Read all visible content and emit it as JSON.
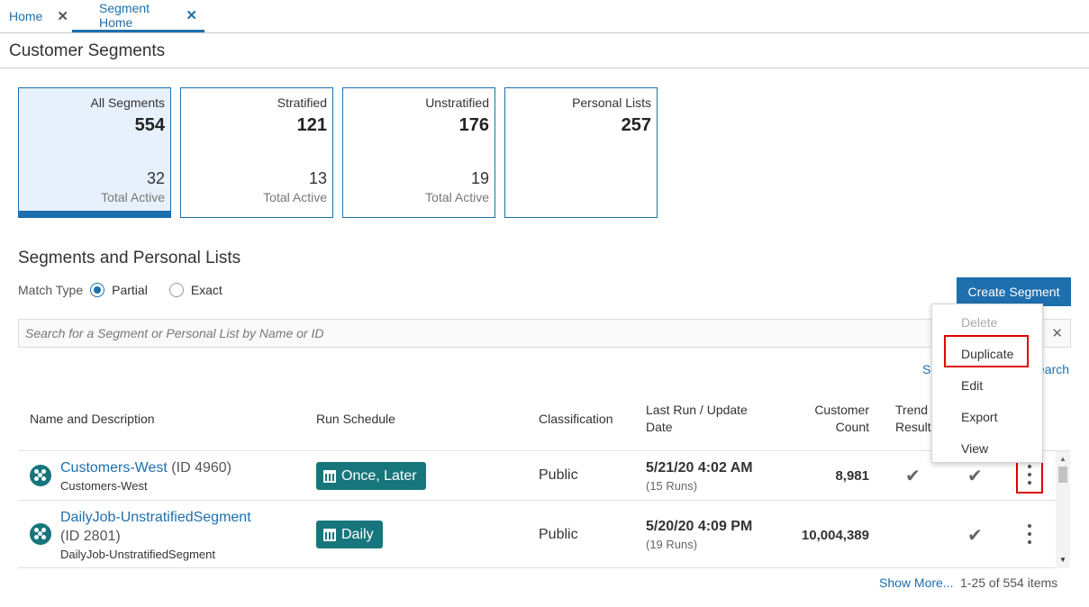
{
  "tabs": [
    {
      "label": "Home"
    },
    {
      "label": "Segment Home"
    }
  ],
  "page_title": "Customer Segments",
  "cards": [
    {
      "label": "All Segments",
      "total": "554",
      "active": "32",
      "active_label": "Total Active"
    },
    {
      "label": "Stratified",
      "total": "121",
      "active": "13",
      "active_label": "Total Active"
    },
    {
      "label": "Unstratified",
      "total": "176",
      "active": "19",
      "active_label": "Total Active"
    },
    {
      "label": "Personal Lists",
      "total": "257"
    }
  ],
  "section_title": "Segments and Personal Lists",
  "match_type": {
    "label": "Match Type",
    "options": [
      "Partial",
      "Exact"
    ],
    "selected": "Partial"
  },
  "create_button": "Create Segment",
  "search": {
    "placeholder": "Search for a Segment or Personal List by Name or ID"
  },
  "links": {
    "left_fragment": "Se",
    "right_fragment": "earch"
  },
  "table": {
    "headers": {
      "name": "Name and Description",
      "schedule": "Run Schedule",
      "classification": "Classification",
      "last_run_1": "Last Run / Update",
      "last_run_2": "Date",
      "count_1": "Customer",
      "count_2": "Count",
      "trend_1": "Trend",
      "trend_2": "Results"
    },
    "rows": [
      {
        "name": "Customers-West",
        "id": "(ID 4960)",
        "description": "Customers-West",
        "schedule": "Once, Later",
        "classification": "Public",
        "last_run": "5/21/20 4:02 AM",
        "runs": "(15 Runs)",
        "count": "8,981"
      },
      {
        "name": "DailyJob-UnstratifiedSegment",
        "id": "(ID 2801)",
        "description": "DailyJob-UnstratifiedSegment",
        "schedule": "Daily",
        "classification": "Public",
        "last_run": "5/20/20 4:09 PM",
        "runs": "(19 Runs)",
        "count": "10,004,389"
      }
    ]
  },
  "context_menu": [
    "Delete",
    "Duplicate",
    "Edit",
    "Export",
    "View"
  ],
  "footer": {
    "show_more": "Show More...",
    "items": "1-25 of 554 items"
  }
}
